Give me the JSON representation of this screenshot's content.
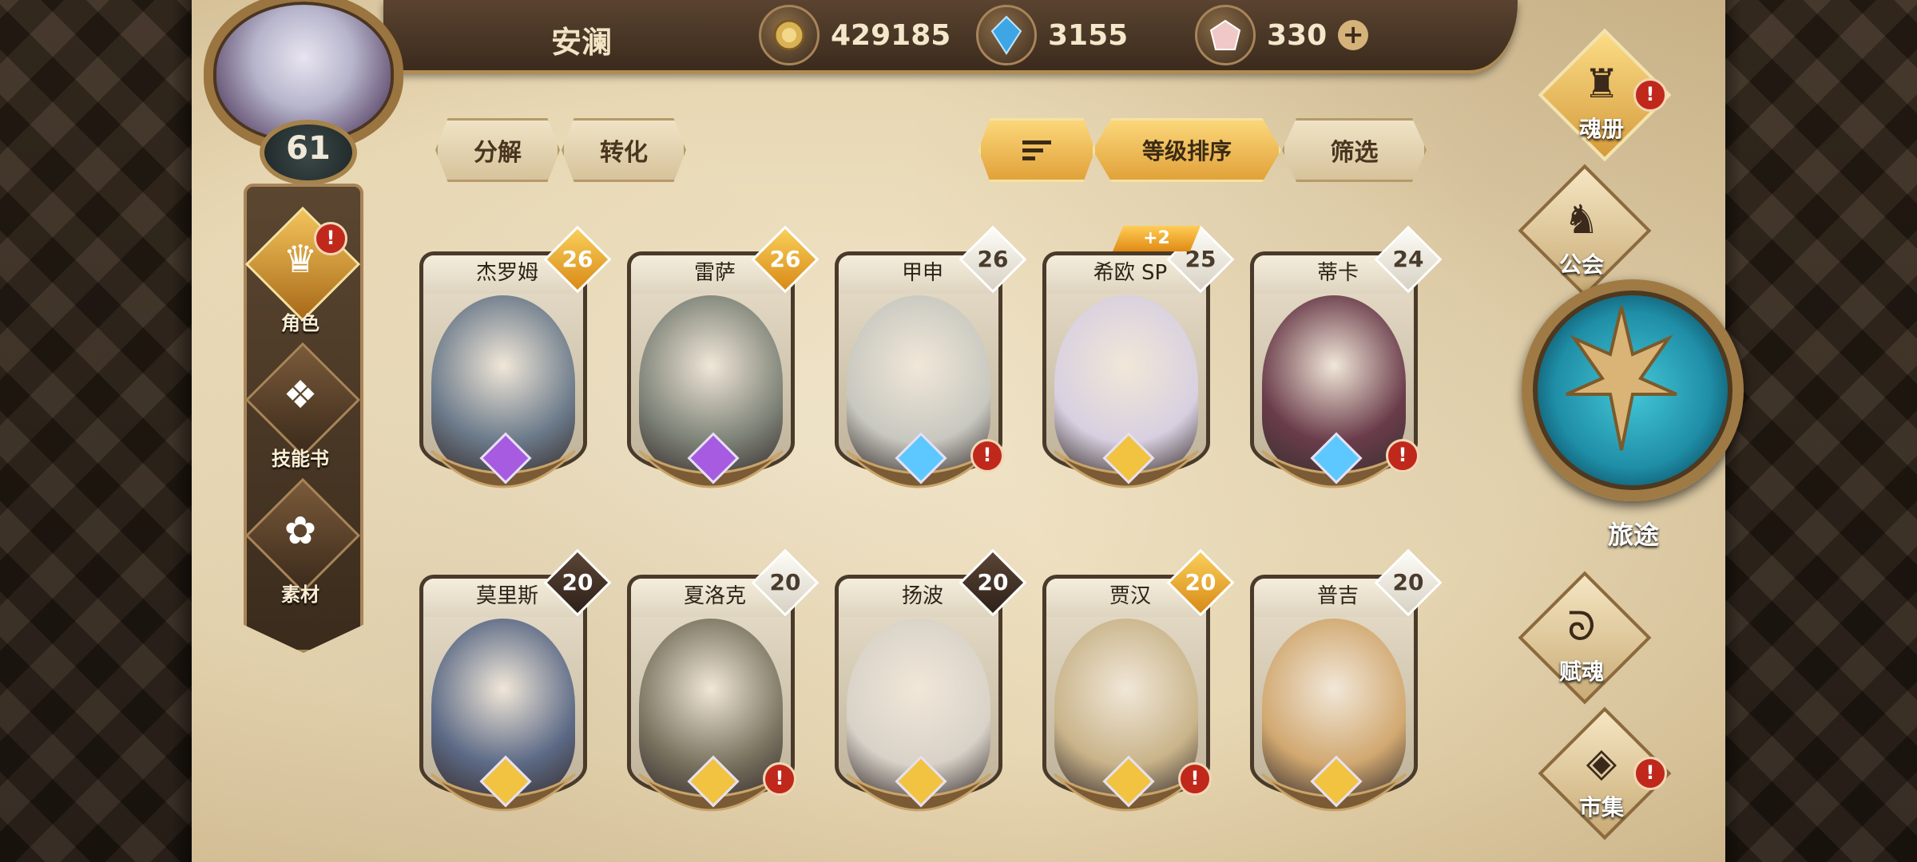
{
  "player": {
    "name": "安澜",
    "level": "61"
  },
  "currencies": [
    {
      "icon": "gold-coin-icon",
      "value": "429185"
    },
    {
      "icon": "blue-crystal-icon",
      "value": "3155"
    },
    {
      "icon": "pink-gem-icon",
      "value": "330"
    }
  ],
  "left_nav": [
    {
      "label": "角色",
      "icon": "character-icon",
      "active": true,
      "alert": true
    },
    {
      "label": "技能书",
      "icon": "skill-book-icon",
      "active": false,
      "alert": false
    },
    {
      "label": "素材",
      "icon": "material-icon",
      "active": false,
      "alert": false
    }
  ],
  "actions": {
    "decompose": "分解",
    "convert": "转化",
    "sort_by_level": "等级排序",
    "filter": "筛选"
  },
  "characters": [
    {
      "name": "杰罗姆",
      "level": "26",
      "badge": "gold",
      "gem": "purple",
      "alert": false,
      "bg": "#6b7a8a",
      "plus": ""
    },
    {
      "name": "雷萨",
      "level": "26",
      "badge": "gold",
      "gem": "purple",
      "alert": false,
      "bg": "#7e8378",
      "plus": ""
    },
    {
      "name": "甲申",
      "level": "26",
      "badge": "white",
      "gem": "blue",
      "alert": true,
      "bg": "#c8c8c0",
      "plus": ""
    },
    {
      "name": "希欧 SP",
      "level": "25",
      "badge": "white",
      "gem": "gold",
      "alert": false,
      "bg": "#d8d0e0",
      "plus": "+2"
    },
    {
      "name": "蒂卡",
      "level": "24",
      "badge": "white",
      "gem": "blue",
      "alert": true,
      "bg": "#6a3c4a",
      "plus": ""
    },
    {
      "name": "莫里斯",
      "level": "20",
      "badge": "dark",
      "gem": "gold",
      "alert": false,
      "bg": "#5c6a86",
      "plus": ""
    },
    {
      "name": "夏洛克",
      "level": "20",
      "badge": "white",
      "gem": "gold",
      "alert": true,
      "bg": "#7a7460",
      "plus": ""
    },
    {
      "name": "扬波",
      "level": "20",
      "badge": "dark",
      "gem": "gold",
      "alert": false,
      "bg": "#d8d2c8",
      "plus": ""
    },
    {
      "name": "贾汉",
      "level": "20",
      "badge": "gold",
      "gem": "gold",
      "alert": true,
      "bg": "#c9b48a",
      "plus": ""
    },
    {
      "name": "普吉",
      "level": "20",
      "badge": "white",
      "gem": "gold",
      "alert": false,
      "bg": "#d1a870",
      "plus": ""
    }
  ],
  "right_menu": [
    {
      "label": "魂册",
      "icon": "soul-book-icon",
      "alert": true,
      "gold": true
    },
    {
      "label": "公会",
      "icon": "guild-icon",
      "alert": false,
      "gold": false
    },
    {
      "label": "赋魂",
      "icon": "soul-infuse-icon",
      "alert": false,
      "gold": false
    },
    {
      "label": "市集",
      "icon": "market-icon",
      "alert": true,
      "gold": false
    }
  ],
  "journey_label": "旅途"
}
